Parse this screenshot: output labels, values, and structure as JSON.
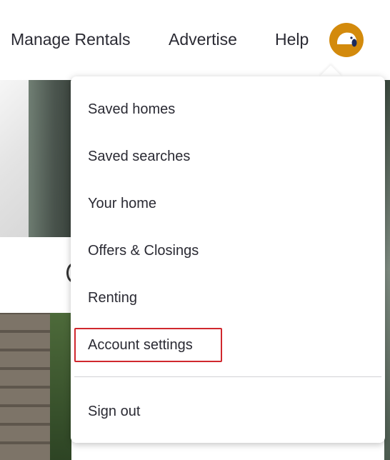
{
  "nav": {
    "manage_rentals": "Manage Rentals",
    "advertise": "Advertise",
    "help": "Help",
    "avatar_icon": "user-avatar-dog-icon",
    "avatar_color": "#d38a0c"
  },
  "menu": {
    "items": [
      {
        "label": "Saved homes"
      },
      {
        "label": "Saved searches"
      },
      {
        "label": "Your home"
      },
      {
        "label": "Offers & Closings"
      },
      {
        "label": "Renting"
      },
      {
        "label": "Account settings",
        "highlighted": true
      },
      {
        "label": "Sign out"
      }
    ],
    "highlight_color": "#d0282e"
  }
}
